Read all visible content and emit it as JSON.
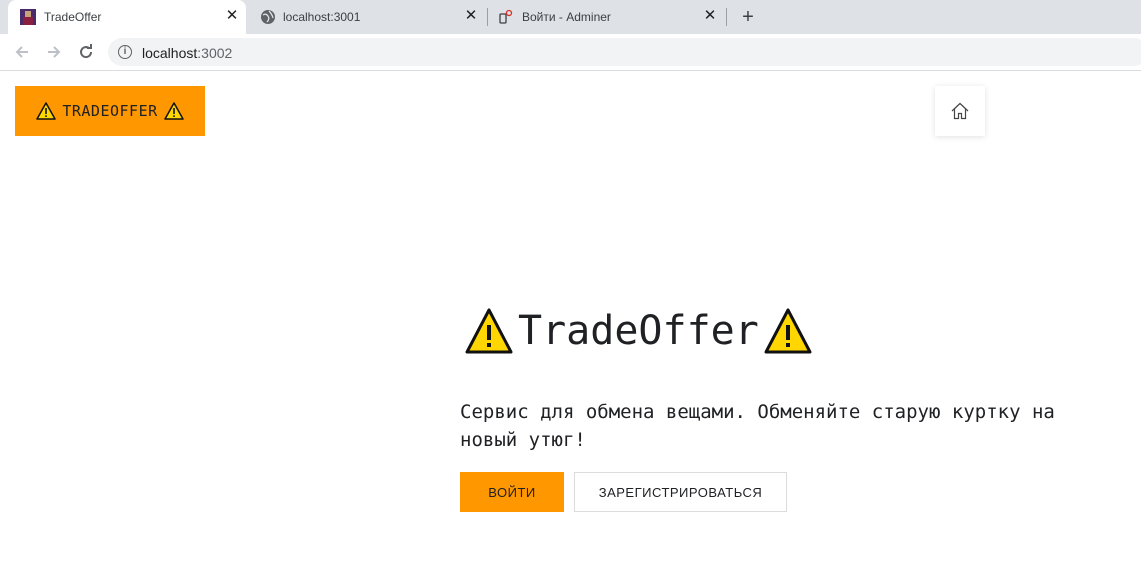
{
  "browser": {
    "tabs": [
      {
        "title": "TradeOffer",
        "favicon": "avatar-favicon",
        "active": true
      },
      {
        "title": "localhost:3001",
        "favicon": "globe-icon",
        "active": false
      },
      {
        "title": "Войти - Adminer",
        "favicon": "adminer-icon",
        "active": false
      }
    ],
    "new_tab": "+",
    "address": {
      "host": "localhost",
      "port": ":3002"
    }
  },
  "header": {
    "logo_label": "TRADEOFFER",
    "home_icon": "home-icon"
  },
  "hero": {
    "title": "TradeOffer",
    "description": "Сервис для обмена вещами. Обменяйте старую куртку на новый утюг!",
    "login_label": "ВОЙТИ",
    "register_label": "ЗАРЕГИСТРИРОВАТЬСЯ"
  },
  "colors": {
    "accent": "#ff9800",
    "warning_yellow": "#ffd600"
  }
}
